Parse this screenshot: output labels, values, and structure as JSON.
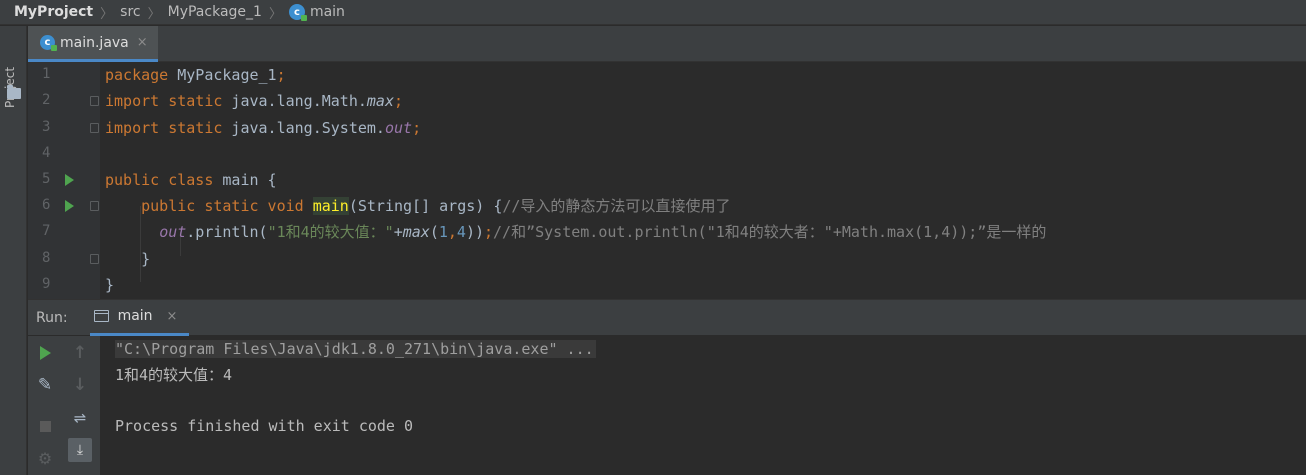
{
  "breadcrumb": {
    "project": "MyProject",
    "src": "src",
    "package": "MyPackage_1",
    "file": "main"
  },
  "sidebar": {
    "project_label": "Project"
  },
  "editor_tab": {
    "label": "main.java",
    "close": "×"
  },
  "gutter": [
    "1",
    "2",
    "3",
    "4",
    "5",
    "6",
    "7",
    "8",
    "9"
  ],
  "code": {
    "l1": {
      "kw": "package",
      "rest": " MyPackage_1",
      "semi": ";"
    },
    "l2": {
      "kw1": "import",
      "kw2": " static",
      "path": " java.lang.Math.",
      "name": "max",
      "semi": ";"
    },
    "l3": {
      "kw1": "import",
      "kw2": " static",
      "path": " java.lang.System.",
      "name": "out",
      "semi": ";"
    },
    "l5": {
      "kw1": "public",
      "kw2": " class",
      "rest": " main {"
    },
    "l6": {
      "kw1": "public",
      "kw2": " static",
      "kw3": " void",
      "sp": " ",
      "method": "main",
      "params": "(String[] args) {",
      "comment": "//导入的静态方法可以直接使用了"
    },
    "l7": {
      "field": "out",
      "call": ".println(",
      "string": "\"1和4的较大值：\"",
      "plus": "+",
      "fn": "max",
      "open": "(",
      "n1": "1",
      "comma": ",",
      "n2": "4",
      "close": "))",
      "semi": ";",
      "comment": "//和”System.out.println(\"1和4的较大者：\"+Math.max(1,4));”是一样的"
    },
    "l8": "}",
    "l9": "}"
  },
  "run": {
    "label": "Run:",
    "tab": "main",
    "close": "×",
    "console": {
      "cmd": "\"C:\\Program Files\\Java\\jdk1.8.0_271\\bin\\java.exe\" ...",
      "output": "1和4的较大值：4",
      "exit": "Process finished with exit code 0"
    }
  },
  "icons": {
    "up": "↑",
    "down": "↓",
    "wrench": "🔧",
    "gear": "⚙",
    "wrap": "⇌",
    "scroll": "⤓"
  }
}
